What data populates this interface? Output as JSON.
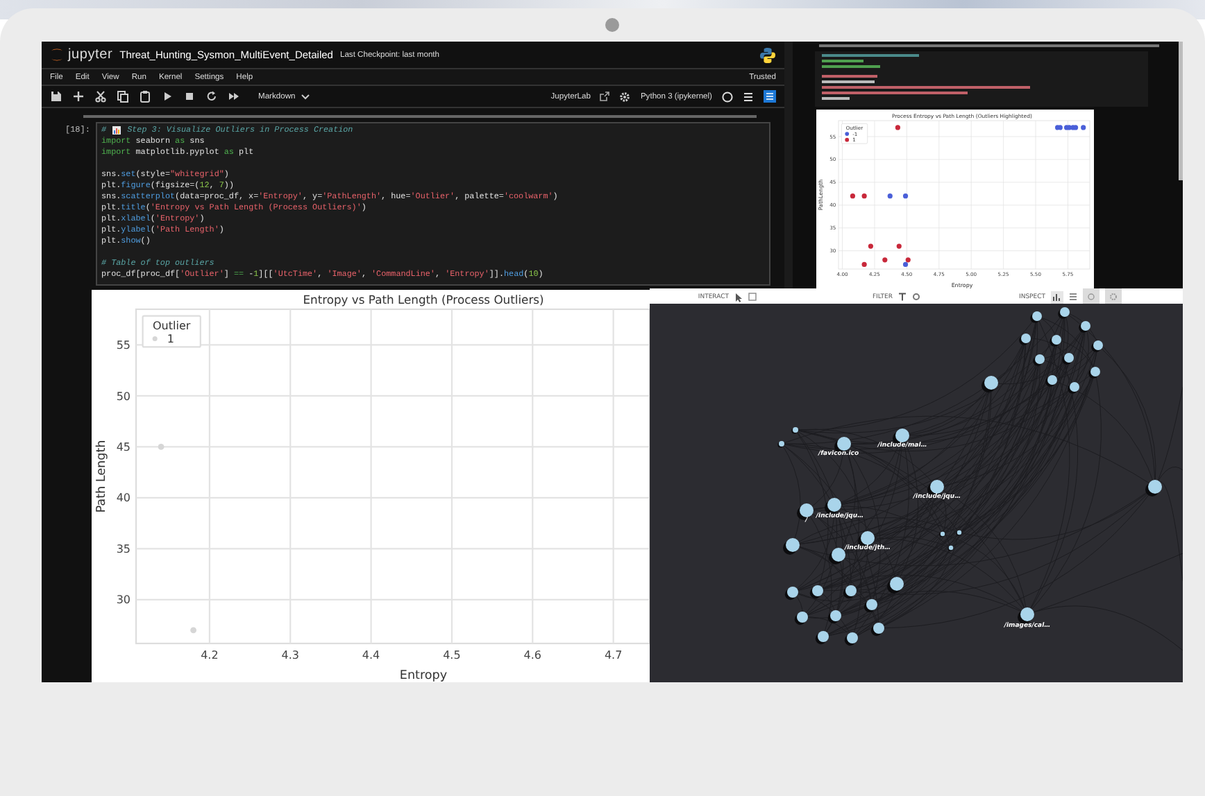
{
  "jupyter": {
    "logo": "jupyter",
    "title": "Threat_Hunting_Sysmon_MultiEvent_Detailed",
    "checkpoint": "Last Checkpoint: last month",
    "menu": [
      "File",
      "Edit",
      "View",
      "Run",
      "Kernel",
      "Settings",
      "Help"
    ],
    "trusted": "Trusted",
    "cell_type": "Markdown",
    "jupyterlab": "JupyterLab",
    "kernel": "Python 3 (ipykernel)",
    "prompt": "[18]:",
    "code": [
      {
        "kind": "code",
        "tokens": [
          {
            "kind": "comment",
            "t": "# "
          },
          {
            "kind": "icon"
          },
          {
            "kind": "comment",
            "t": " Step 3: Visualize Outliers in Process Creation"
          }
        ]
      },
      {
        "kind": "code",
        "tokens": [
          {
            "kind": "keyword",
            "t": "import"
          },
          {
            "kind": "plain",
            "t": " seaborn "
          },
          {
            "kind": "keyword",
            "t": "as"
          },
          {
            "kind": "plain",
            "t": " sns"
          }
        ]
      },
      {
        "kind": "code",
        "tokens": [
          {
            "kind": "keyword",
            "t": "import"
          },
          {
            "kind": "plain",
            "t": " matplotlib.pyplot "
          },
          {
            "kind": "keyword",
            "t": "as"
          },
          {
            "kind": "plain",
            "t": " plt"
          }
        ]
      },
      {
        "kind": "blank"
      },
      {
        "kind": "code",
        "tokens": [
          {
            "kind": "plain",
            "t": "sns."
          },
          {
            "kind": "function",
            "t": "set"
          },
          {
            "kind": "plain",
            "t": "(style="
          },
          {
            "kind": "string",
            "t": "\"whitegrid\""
          },
          {
            "kind": "plain",
            "t": ")"
          }
        ]
      },
      {
        "kind": "code",
        "tokens": [
          {
            "kind": "plain",
            "t": "plt."
          },
          {
            "kind": "function",
            "t": "figure"
          },
          {
            "kind": "plain",
            "t": "(figsize=("
          },
          {
            "kind": "number",
            "t": "12"
          },
          {
            "kind": "plain",
            "t": ", "
          },
          {
            "kind": "number",
            "t": "7"
          },
          {
            "kind": "plain",
            "t": "))"
          }
        ]
      },
      {
        "kind": "code",
        "tokens": [
          {
            "kind": "plain",
            "t": "sns."
          },
          {
            "kind": "function",
            "t": "scatterplot"
          },
          {
            "kind": "plain",
            "t": "(data=proc_df, x="
          },
          {
            "kind": "string",
            "t": "'Entropy'"
          },
          {
            "kind": "plain",
            "t": ", y="
          },
          {
            "kind": "string",
            "t": "'PathLength'"
          },
          {
            "kind": "plain",
            "t": ", hue="
          },
          {
            "kind": "string",
            "t": "'Outlier'"
          },
          {
            "kind": "plain",
            "t": ", palette="
          },
          {
            "kind": "string",
            "t": "'coolwarm'"
          },
          {
            "kind": "plain",
            "t": ")"
          }
        ]
      },
      {
        "kind": "code",
        "tokens": [
          {
            "kind": "plain",
            "t": "plt."
          },
          {
            "kind": "function",
            "t": "title"
          },
          {
            "kind": "plain",
            "t": "("
          },
          {
            "kind": "string",
            "t": "'Entropy vs Path Length (Process Outliers)'"
          },
          {
            "kind": "plain",
            "t": ")"
          }
        ]
      },
      {
        "kind": "code",
        "tokens": [
          {
            "kind": "plain",
            "t": "plt."
          },
          {
            "kind": "function",
            "t": "xlabel"
          },
          {
            "kind": "plain",
            "t": "("
          },
          {
            "kind": "string",
            "t": "'Entropy'"
          },
          {
            "kind": "plain",
            "t": ")"
          }
        ]
      },
      {
        "kind": "code",
        "tokens": [
          {
            "kind": "plain",
            "t": "plt."
          },
          {
            "kind": "function",
            "t": "ylabel"
          },
          {
            "kind": "plain",
            "t": "("
          },
          {
            "kind": "string",
            "t": "'Path Length'"
          },
          {
            "kind": "plain",
            "t": ")"
          }
        ]
      },
      {
        "kind": "code",
        "tokens": [
          {
            "kind": "plain",
            "t": "plt."
          },
          {
            "kind": "function",
            "t": "show"
          },
          {
            "kind": "plain",
            "t": "()"
          }
        ]
      },
      {
        "kind": "blank"
      },
      {
        "kind": "code",
        "tokens": [
          {
            "kind": "comment",
            "t": "# Table of top outliers"
          }
        ]
      },
      {
        "kind": "code",
        "tokens": [
          {
            "kind": "plain",
            "t": "proc_df[proc_df["
          },
          {
            "kind": "string",
            "t": "'Outlier'"
          },
          {
            "kind": "plain",
            "t": "] "
          },
          {
            "kind": "operator",
            "t": "=="
          },
          {
            "kind": "plain",
            "t": " -"
          },
          {
            "kind": "number",
            "t": "1"
          },
          {
            "kind": "plain",
            "t": "][["
          },
          {
            "kind": "string",
            "t": "'UtcTime'"
          },
          {
            "kind": "plain",
            "t": ", "
          },
          {
            "kind": "string",
            "t": "'Image'"
          },
          {
            "kind": "plain",
            "t": ", "
          },
          {
            "kind": "string",
            "t": "'CommandLine'"
          },
          {
            "kind": "plain",
            "t": ", "
          },
          {
            "kind": "string",
            "t": "'Entropy'"
          },
          {
            "kind": "plain",
            "t": "]]."
          },
          {
            "kind": "function",
            "t": "head"
          },
          {
            "kind": "plain",
            "t": "("
          },
          {
            "kind": "number",
            "t": "10"
          },
          {
            "kind": "plain",
            "t": ")"
          }
        ]
      }
    ]
  },
  "inset_screenshot": {
    "chart_data": {
      "type": "scatter",
      "title": "Process Entropy vs Path Length (Outliers Highlighted)",
      "xlabel": "Entropy",
      "ylabel": "PathLength",
      "grid": true,
      "legend": {
        "title": "Outlier"
      },
      "xlim": [
        3.97,
        5.92
      ],
      "ylim": [
        26,
        58.5
      ],
      "xticks": [
        {
          "value": 4,
          "label": "4.00"
        },
        {
          "value": 4.25,
          "label": "4.25"
        },
        {
          "value": 4.5,
          "label": "4.50"
        },
        {
          "value": 4.75,
          "label": "4.75"
        },
        {
          "value": 5,
          "label": "5.00"
        },
        {
          "value": 5.25,
          "label": "5.25"
        },
        {
          "value": 5.5,
          "label": "5.50"
        },
        {
          "value": 5.75,
          "label": "5.75"
        }
      ],
      "yticks": [
        30,
        35,
        40,
        45,
        50,
        55
      ],
      "series": [
        {
          "name": "-1",
          "color": "#4a5fd8",
          "x": [
            4.37,
            4.49,
            4.49,
            5.67,
            5.69,
            5.74,
            5.76,
            5.79,
            5.81,
            5.87
          ],
          "values": [
            42,
            42,
            27,
            57,
            57,
            57,
            57,
            57,
            57,
            57
          ]
        },
        {
          "name": "1",
          "color": "#c8283a",
          "x": [
            4.43,
            4.08,
            4.17,
            4.22,
            4.44,
            4.17,
            4.33,
            4.51
          ],
          "values": [
            57,
            42,
            42,
            31,
            31,
            27,
            28,
            28
          ]
        }
      ]
    }
  },
  "output_chart": {
    "chart_data": {
      "type": "scatter",
      "title": "Entropy vs Path Length (Process Outliers)",
      "xlabel": "Entropy",
      "ylabel": "Path Length",
      "grid": true,
      "legend": {
        "title": "Outlier"
      },
      "xlim": [
        4.109,
        4.745
      ],
      "ylim": [
        25.7,
        58.5
      ],
      "xticks": [
        4.2,
        4.3,
        4.4,
        4.5,
        4.6,
        4.7
      ],
      "yticks": [
        30,
        35,
        40,
        45,
        50,
        55
      ],
      "series": [
        {
          "name": "1",
          "color": "#d6d6d6",
          "x": [
            4.14,
            4.18
          ],
          "values": [
            45,
            27
          ]
        }
      ]
    }
  },
  "graph_view": {
    "toolbar": [
      "INTERACT",
      "FILTER",
      "INSPECT"
    ],
    "node_labels": [
      "/favicon.ico",
      "/include/mal…",
      "/include/jqu…",
      "/",
      "/include/jqu…",
      "/include/jth…",
      "/images/cal…"
    ]
  }
}
